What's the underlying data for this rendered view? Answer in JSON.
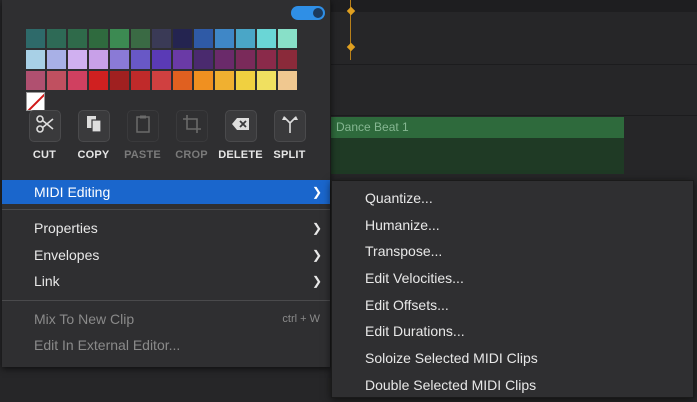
{
  "palette": {
    "rows": [
      [
        "#2e6a6a",
        "#2e6a56",
        "#2f6a4a",
        "#2f6a3e",
        "#3c8a52",
        "#3a6a44",
        "#3a3a56",
        "#242450",
        "#2f5aa6",
        "#3f87c7",
        "#4aa6c7",
        "#6ad6d6",
        "#88e0c8"
      ],
      [
        "#a8d0e6",
        "#a8b0e6",
        "#d0b0f0",
        "#c8a0e8",
        "#8a7ad6",
        "#6858c6",
        "#5a3ab6",
        "#6a3aa6",
        "#4a2a6e",
        "#6a2a6a",
        "#7a2a5a",
        "#8a2a4a",
        "#8a2a3a"
      ],
      [
        "#b05070",
        "#c05060",
        "#d04060",
        "#d02020",
        "#a02020",
        "#c02a2a",
        "#d04040",
        "#e06020",
        "#f09020",
        "#f0b030",
        "#f0d040",
        "#f0e060",
        "#f0c890",
        "none"
      ]
    ]
  },
  "tools": [
    {
      "label": "CUT",
      "icon": "scissors-icon",
      "enabled": true
    },
    {
      "label": "COPY",
      "icon": "copy-icon",
      "enabled": true
    },
    {
      "label": "PASTE",
      "icon": "clipboard-icon",
      "enabled": false
    },
    {
      "label": "CROP",
      "icon": "crop-icon",
      "enabled": false
    },
    {
      "label": "DELETE",
      "icon": "backspace-icon",
      "enabled": true
    },
    {
      "label": "SPLIT",
      "icon": "split-icon",
      "enabled": true
    }
  ],
  "menu": {
    "midi_editing": "MIDI Editing",
    "properties": "Properties",
    "envelopes": "Envelopes",
    "link": "Link",
    "mix_to_new_clip": "Mix To New Clip",
    "mix_shortcut": "ctrl + W",
    "edit_external": "Edit In External Editor..."
  },
  "submenu": {
    "items": [
      "Quantize...",
      "Humanize...",
      "Transpose...",
      "Edit Velocities...",
      "Edit Offsets...",
      "Edit Durations...",
      "Soloize Selected MIDI Clips",
      "Double Selected MIDI Clips"
    ]
  },
  "background": {
    "clip_title": "Dance Beat 1"
  },
  "colors": {
    "accent": "#1a66cc",
    "toggle": "#2f8fe6",
    "clip_green": "#2e6a3c"
  }
}
